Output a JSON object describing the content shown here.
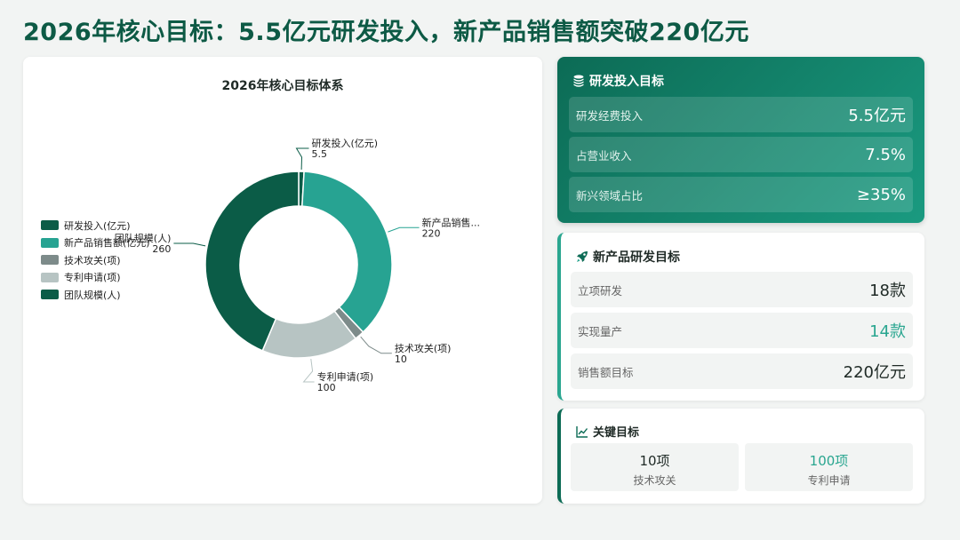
{
  "page_title": "2026年核心目标：5.5亿元研发投入，新产品销售额突破220亿元",
  "chart_data": {
    "type": "pie",
    "title": "2026年核心目标体系",
    "donut": true,
    "legend_position": "left",
    "categories": [
      "研发投入(亿元)",
      "新产品销售额(亿元)",
      "技术攻关(项)",
      "专利申请(项)",
      "团队规模(人)"
    ],
    "slice_labels": [
      "研发投入(亿元)",
      "新产品销售...",
      "技术攻关(项)",
      "专利申请(项)",
      "团队规模(人)"
    ],
    "values": [
      5.5,
      220,
      10,
      100,
      260
    ],
    "colors": [
      "#0b5c47",
      "#27a392",
      "#7d8b8a",
      "#b7c4c3",
      "#0b5c47"
    ]
  },
  "rd_card": {
    "title": "研发投入目标",
    "icon": "coins-icon",
    "rows": [
      {
        "label": "研发经费投入",
        "value": "5.5亿元"
      },
      {
        "label": "占营业收入",
        "value": "7.5%"
      },
      {
        "label": "新兴领域占比",
        "value": "≥35%"
      }
    ]
  },
  "new_product_card": {
    "title": "新产品研发目标",
    "icon": "rocket-icon",
    "accent_color": "#2aa690",
    "rows": [
      {
        "label": "立项研发",
        "value": "18款"
      },
      {
        "label": "实现量产",
        "value": "14款"
      },
      {
        "label": "销售额目标",
        "value": "220亿元"
      }
    ]
  },
  "key_targets_card": {
    "title": "关键目标",
    "icon": "line-chart-icon",
    "items": [
      {
        "value": "10项",
        "label": "技术攻关"
      },
      {
        "value": "100项",
        "label": "专利申请"
      }
    ]
  }
}
